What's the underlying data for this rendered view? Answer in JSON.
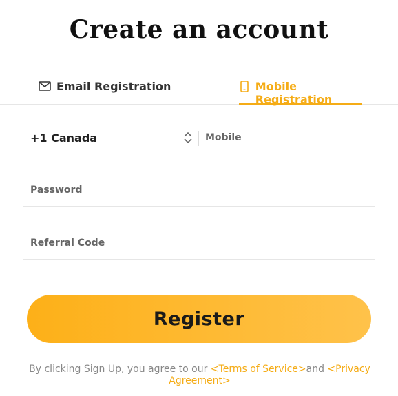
{
  "page": {
    "title": "Create an account"
  },
  "tabs": [
    {
      "label": "Email Registration",
      "icon": "mail-icon",
      "active": false
    },
    {
      "label": "Mobile Registration",
      "icon": "phone-icon",
      "active": true
    }
  ],
  "form": {
    "country_code": "+1 Canada",
    "mobile_placeholder": "Mobile",
    "password_placeholder": "Password",
    "referral_placeholder": "Referral Code"
  },
  "register_label": "Register",
  "terms": {
    "prefix": "By clicking Sign Up, you agree to our ",
    "terms_link": "<Terms of Service>",
    "middle": "and ",
    "privacy_link": "<Privacy Agreement>"
  },
  "colors": {
    "accent": "#f5ac16",
    "button_start": "#fdb018",
    "button_end": "#ffc24a"
  }
}
